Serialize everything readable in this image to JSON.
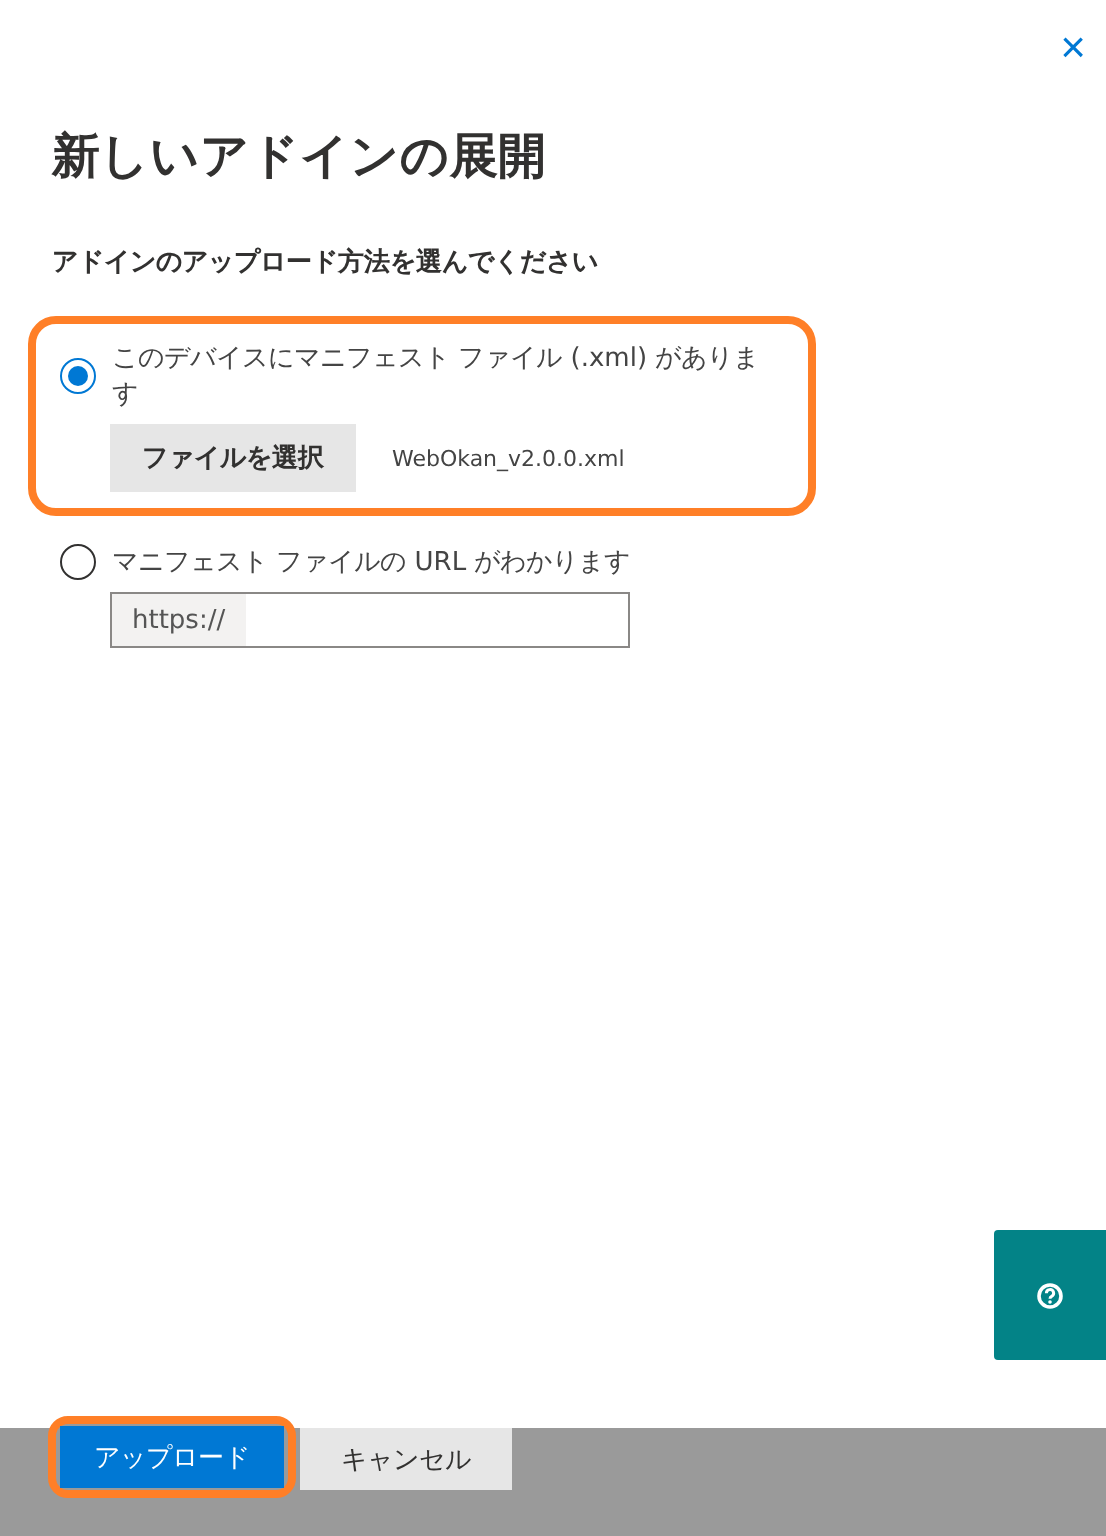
{
  "close": {
    "label": "×"
  },
  "title": "新しいアドインの展開",
  "subtitle": "アドインのアップロード方法を選んでください",
  "options": [
    {
      "kind": "file",
      "label": "このデバイスにマニフェスト ファイル (.xml) があります",
      "selected": true,
      "highlighted": true,
      "button": "ファイルを選択",
      "file_name": "WebOkan_v2.0.0.xml"
    },
    {
      "kind": "url",
      "label": "マニフェスト ファイルの URL がわかります",
      "selected": false,
      "highlighted": false,
      "prefix": "https://"
    }
  ],
  "footer": {
    "buttons": [
      {
        "label": "アップロード",
        "primary": true,
        "highlighted": true
      },
      {
        "label": "キャンセル",
        "primary": false,
        "highlighted": false
      }
    ]
  }
}
